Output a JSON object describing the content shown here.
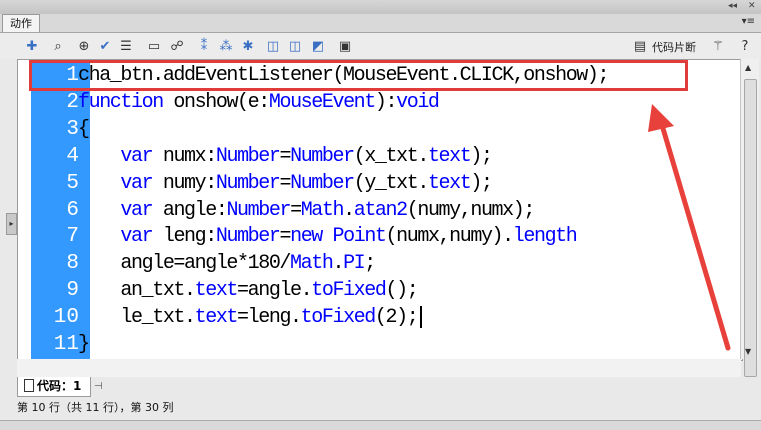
{
  "panel": {
    "tab_label": "动作",
    "title_controls": "◂◂",
    "menu_glyph": "▾≡"
  },
  "toolbar": {
    "snippet_label": "代码片断",
    "icons": [
      "add-script-icon",
      "find-icon",
      "target-icon",
      "check-syntax-icon",
      "format-icon",
      "code-hint-icon",
      "debug-icon",
      "collapse-icon",
      "collapse-selection-icon",
      "expand-all-icon",
      "comment-block-icon",
      "comment-line-icon",
      "remove-comment-icon",
      "show-hide-toolbox-icon",
      "code-snippets-icon",
      "wand-icon",
      "help-icon"
    ]
  },
  "editor": {
    "lines": [
      {
        "n": "1",
        "parts": [
          {
            "t": "cha_btn.addEventListener(MouseEvent.CLICK,onshow);",
            "c": ""
          }
        ]
      },
      {
        "n": "2",
        "parts": [
          {
            "t": "function",
            "c": "kw"
          },
          {
            "t": " onshow(e:",
            "c": ""
          },
          {
            "t": "MouseEvent",
            "c": "ty"
          },
          {
            "t": "):",
            "c": ""
          },
          {
            "t": "void",
            "c": "kw"
          }
        ]
      },
      {
        "n": "3",
        "parts": [
          {
            "t": "{",
            "c": ""
          }
        ]
      },
      {
        "n": "4",
        "parts": [
          {
            "t": "    ",
            "c": ""
          },
          {
            "t": "var",
            "c": "kw"
          },
          {
            "t": " numx:",
            "c": ""
          },
          {
            "t": "Number",
            "c": "ty"
          },
          {
            "t": "=",
            "c": ""
          },
          {
            "t": "Number",
            "c": "ty"
          },
          {
            "t": "(x_txt.",
            "c": ""
          },
          {
            "t": "text",
            "c": "ty"
          },
          {
            "t": ");",
            "c": ""
          }
        ]
      },
      {
        "n": "5",
        "parts": [
          {
            "t": "    ",
            "c": ""
          },
          {
            "t": "var",
            "c": "kw"
          },
          {
            "t": " numy:",
            "c": ""
          },
          {
            "t": "Number",
            "c": "ty"
          },
          {
            "t": "=",
            "c": ""
          },
          {
            "t": "Number",
            "c": "ty"
          },
          {
            "t": "(y_txt.",
            "c": ""
          },
          {
            "t": "text",
            "c": "ty"
          },
          {
            "t": ");",
            "c": ""
          }
        ]
      },
      {
        "n": "6",
        "parts": [
          {
            "t": "    ",
            "c": ""
          },
          {
            "t": "var",
            "c": "kw"
          },
          {
            "t": " angle:",
            "c": ""
          },
          {
            "t": "Number",
            "c": "ty"
          },
          {
            "t": "=",
            "c": ""
          },
          {
            "t": "Math",
            "c": "ty"
          },
          {
            "t": ".",
            "c": ""
          },
          {
            "t": "atan2",
            "c": "ty"
          },
          {
            "t": "(numy,numx);",
            "c": ""
          }
        ]
      },
      {
        "n": "7",
        "parts": [
          {
            "t": "    ",
            "c": ""
          },
          {
            "t": "var",
            "c": "kw"
          },
          {
            "t": " leng:",
            "c": ""
          },
          {
            "t": "Number",
            "c": "ty"
          },
          {
            "t": "=",
            "c": ""
          },
          {
            "t": "new",
            "c": "kw"
          },
          {
            "t": " ",
            "c": ""
          },
          {
            "t": "Point",
            "c": "ty"
          },
          {
            "t": "(numx,numy).",
            "c": ""
          },
          {
            "t": "length",
            "c": "ty"
          }
        ]
      },
      {
        "n": "8",
        "parts": [
          {
            "t": "    angle=angle*180/",
            "c": ""
          },
          {
            "t": "Math",
            "c": "ty"
          },
          {
            "t": ".",
            "c": ""
          },
          {
            "t": "PI",
            "c": "ty"
          },
          {
            "t": ";",
            "c": ""
          }
        ]
      },
      {
        "n": "9",
        "parts": [
          {
            "t": "    an_txt.",
            "c": ""
          },
          {
            "t": "text",
            "c": "ty"
          },
          {
            "t": "=angle.",
            "c": ""
          },
          {
            "t": "toFixed",
            "c": "ty"
          },
          {
            "t": "();",
            "c": ""
          }
        ]
      },
      {
        "n": "10",
        "parts": [
          {
            "t": "    le_txt.",
            "c": ""
          },
          {
            "t": "text",
            "c": "ty"
          },
          {
            "t": "=leng.",
            "c": ""
          },
          {
            "t": "toFixed",
            "c": "ty"
          },
          {
            "t": "(2);",
            "c": ""
          }
        ],
        "cursor": true
      },
      {
        "n": "11",
        "parts": [
          {
            "t": "}",
            "c": ""
          }
        ]
      }
    ]
  },
  "bottom": {
    "code_tab_label": "代码：1",
    "status": "第 10 行（共 11 行），第 30 列"
  },
  "colors": {
    "gutter": "#3399ff",
    "keyword": "#0000ff",
    "highlight_box": "#e03c3c",
    "arrow": "#e8403a"
  }
}
